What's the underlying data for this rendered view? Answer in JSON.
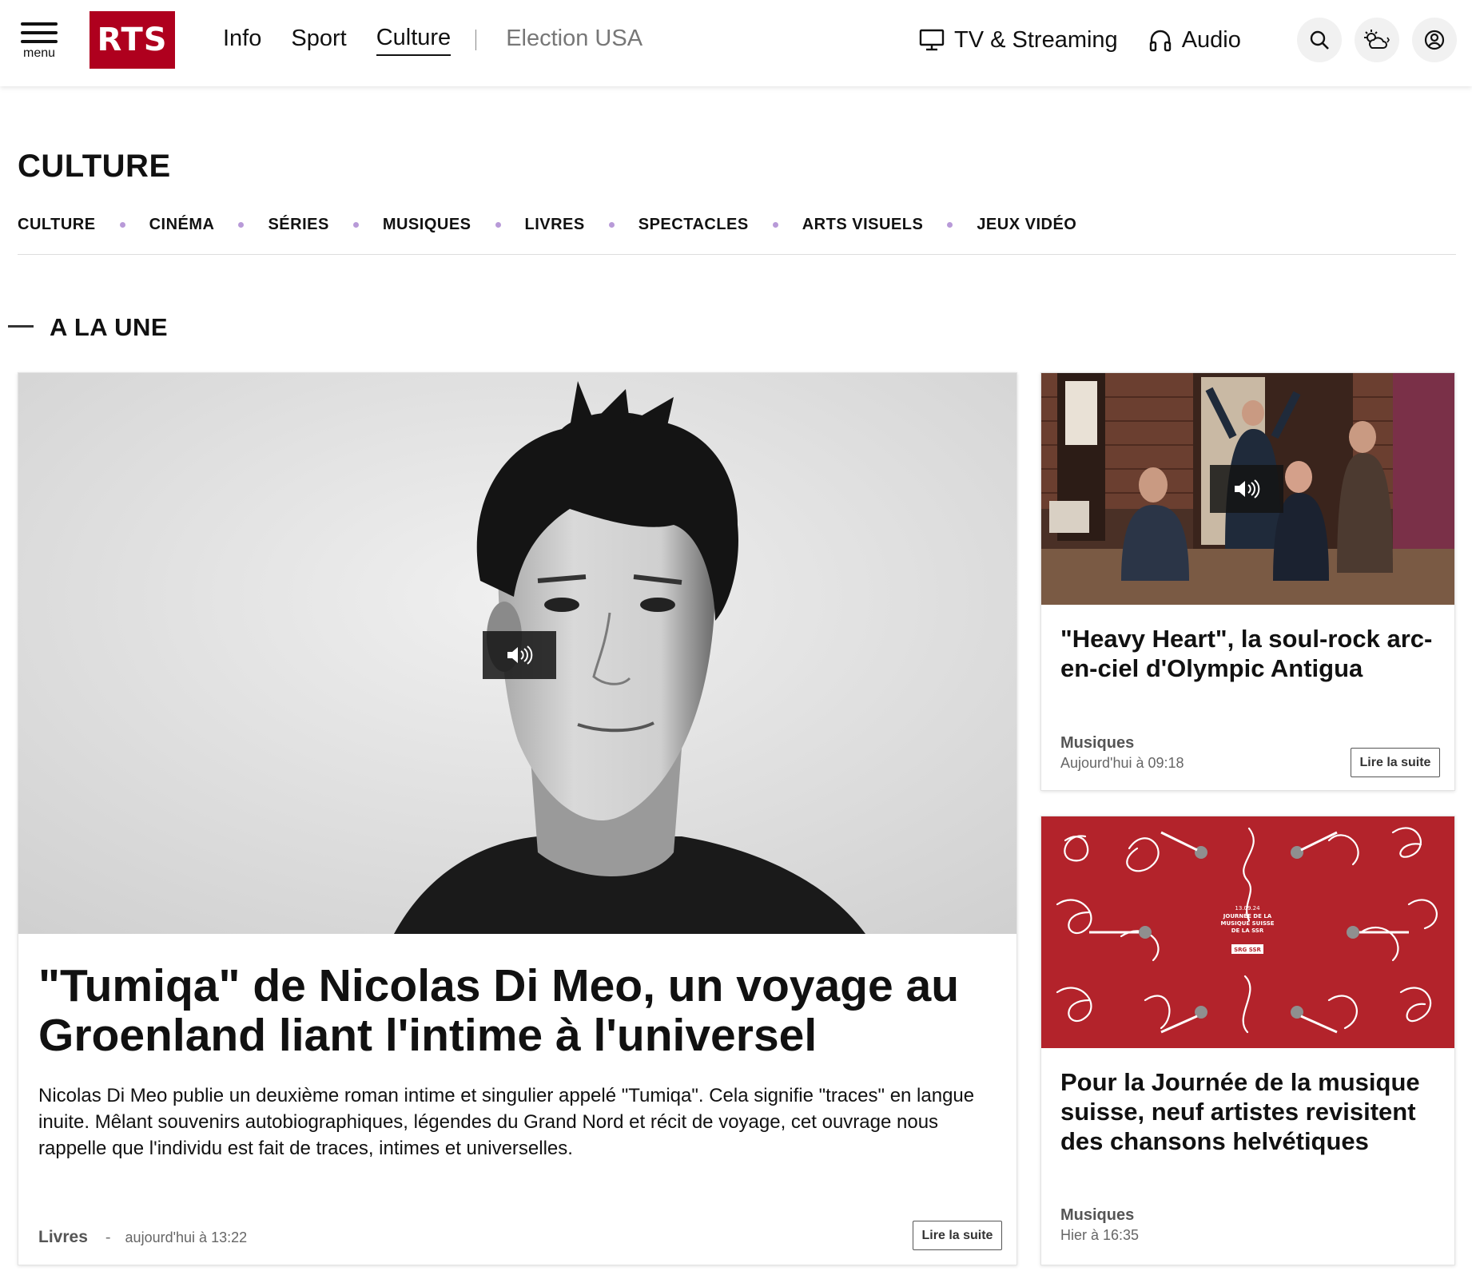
{
  "header": {
    "menu_label": "menu",
    "logo_text": "RTS",
    "nav": [
      "Info",
      "Sport",
      "Culture"
    ],
    "nav_extra": "Election USA",
    "tv_label": "TV & Streaming",
    "audio_label": "Audio"
  },
  "section": {
    "title": "CULTURE",
    "subnav": [
      "CULTURE",
      "CINÉMA",
      "SÉRIES",
      "MUSIQUES",
      "LIVRES",
      "SPECTACLES",
      "ARTS VISUELS",
      "JEUX VIDÉO"
    ],
    "une_title": "A LA UNE"
  },
  "main_article": {
    "headline": "\"Tumiqa\" de Nicolas Di Meo, un voyage au Groenland liant l'intime à l'universel",
    "lead": "Nicolas Di Meo publie un deuxième roman intime et singulier appelé \"Tumiqa\". Cela signifie \"traces\" en langue inuite. Mêlant souvenirs autobiographiques, légendes du Grand Nord et récit de voyage, cet ouvrage nous rappelle que l'individu est fait de traces, intimes et universelles.",
    "rubric": "Livres",
    "separator": "-",
    "date": "aujourd'hui à 13:22",
    "more_label": "Lire la suite"
  },
  "side_article_1": {
    "headline": "\"Heavy Heart\", la soul-rock arc-en-ciel d'Olympic Antigua",
    "rubric": "Musiques",
    "date": "Aujourd'hui à 09:18",
    "more_label": "Lire la suite"
  },
  "side_article_2": {
    "headline": "Pour la Journée de la musique suisse, neuf artistes revisitent des chansons helvétiques",
    "rubric": "Musiques",
    "date": "Hier à 16:35",
    "poster_date": "13.09.24",
    "poster_line1": "JOURNÉE DE LA",
    "poster_line2": "MUSIQUE SUISSE",
    "poster_line3": "DE LA SSR",
    "poster_badge": "SRG SSR"
  },
  "colors": {
    "brand_red": "#af001e",
    "subnav_dot": "#b89ad8",
    "poster_red": "#b3232b"
  }
}
